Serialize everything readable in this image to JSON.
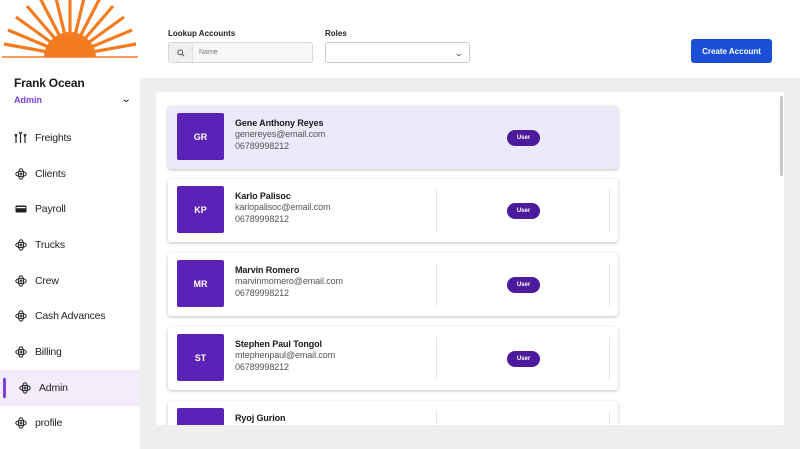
{
  "app": {
    "brand_color": "#f47b20",
    "accent": "#7b3fe0",
    "primary_button": "#1a4fd6"
  },
  "user": {
    "name": "Frank Ocean",
    "role": "Admin"
  },
  "sidebar": {
    "items": [
      {
        "label": "Freights",
        "icon": "freight-icon",
        "active": false
      },
      {
        "label": "Clients",
        "icon": "network-icon",
        "active": false
      },
      {
        "label": "Payroll",
        "icon": "card-icon",
        "active": false
      },
      {
        "label": "Trucks",
        "icon": "network-icon",
        "active": false
      },
      {
        "label": "Crew",
        "icon": "network-icon",
        "active": false
      },
      {
        "label": "Cash Advances",
        "icon": "network-icon",
        "active": false
      },
      {
        "label": "Billing",
        "icon": "network-icon",
        "active": false
      },
      {
        "label": "Admin",
        "icon": "network-icon",
        "active": true
      },
      {
        "label": "profile",
        "icon": "network-icon",
        "active": false
      }
    ]
  },
  "toolbar": {
    "lookup_label": "Lookup Accounts",
    "search_placeholder": "Name",
    "roles_label": "Roles",
    "roles_value": "",
    "create_label": "Create Account"
  },
  "accounts": [
    {
      "initials": "GR",
      "name": "Gene Anthony Reyes",
      "email": "genereyes@email.com",
      "phone": "06789998212",
      "role": "User",
      "selected": true
    },
    {
      "initials": "KP",
      "name": "Karlo Palisoc",
      "email": "karlopalisoc@email.com",
      "phone": "06789998212",
      "role": "User",
      "selected": false
    },
    {
      "initials": "MR",
      "name": "Marvin Romero",
      "email": "marvinmomero@email.com",
      "phone": "06789998212",
      "role": "User",
      "selected": false
    },
    {
      "initials": "ST",
      "name": "Stephen Paul Tongol",
      "email": "mtephenpaul@email.com",
      "phone": "06789998212",
      "role": "User",
      "selected": false
    },
    {
      "initials": "",
      "name": "Ryoj Gurion",
      "email": "",
      "phone": "",
      "role": "",
      "selected": false
    }
  ]
}
